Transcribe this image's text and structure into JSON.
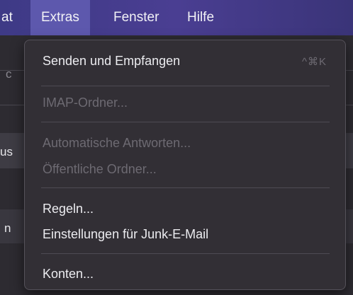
{
  "menubar": {
    "items": [
      {
        "label": "at",
        "active": false
      },
      {
        "label": "Extras",
        "active": true
      },
      {
        "label": "Fenster",
        "active": false
      },
      {
        "label": "Hilfe",
        "active": false
      }
    ]
  },
  "background": {
    "fragments": [
      "c",
      "us",
      "n"
    ]
  },
  "menu": {
    "items": [
      {
        "label": "Senden und Empfangen",
        "shortcut": "^⌘K",
        "enabled": true
      },
      {
        "label": "IMAP-Ordner...",
        "enabled": false
      },
      {
        "label": "Automatische Antworten...",
        "enabled": false
      },
      {
        "label": "Öffentliche Ordner...",
        "enabled": false
      },
      {
        "label": "Regeln...",
        "enabled": true
      },
      {
        "label": "Einstellungen für Junk-E-Mail",
        "enabled": true
      },
      {
        "label": "Konten...",
        "enabled": true
      }
    ]
  },
  "colors": {
    "menubar": "#4a3e92",
    "menubar_active": "#5d58ad",
    "menu_bg": "#322f35",
    "text_enabled": "#ececf0",
    "text_disabled": "#6d6a72"
  }
}
